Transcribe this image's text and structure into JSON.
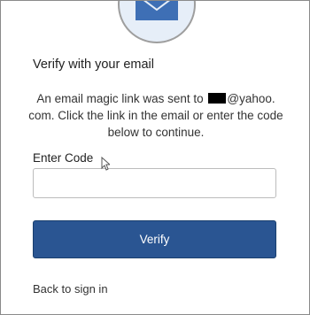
{
  "header": {
    "icon": "mail-icon",
    "title": "Verify with your email"
  },
  "message": {
    "prefix": "An email magic link was sent to ",
    "email_suffix": "@yahoo.",
    "rest": "com. Click the link in the email or enter the code below to continue."
  },
  "code": {
    "label": "Enter Code",
    "value": "",
    "placeholder": ""
  },
  "actions": {
    "verify_label": "Verify",
    "back_label": "Back to sign in"
  },
  "colors": {
    "primary": "#2a5592",
    "avatar_bg": "#e6eef8",
    "icon": "#3e6fb5"
  }
}
